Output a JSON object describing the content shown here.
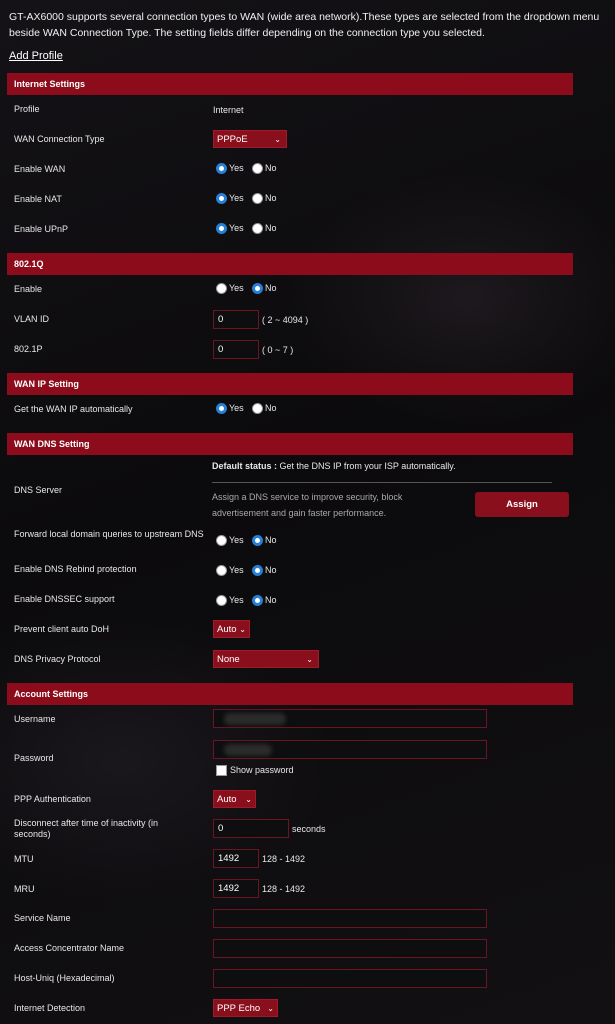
{
  "intro": "GT-AX6000 supports several connection types to WAN (wide area network).These types are selected from the dropdown menu beside WAN Connection Type. The setting fields differ depending on the connection type you selected.",
  "add_profile": "Add Profile",
  "yes": "Yes",
  "no": "No",
  "internet_settings": {
    "title": "Internet Settings",
    "profile_label": "Profile",
    "profile_value": "Internet",
    "wan_type_label": "WAN Connection Type",
    "wan_type_value": "PPPoE",
    "enable_wan_label": "Enable WAN",
    "enable_nat_label": "Enable NAT",
    "enable_upnp_label": "Enable UPnP"
  },
  "dot1q": {
    "title": "802.1Q",
    "enable_label": "Enable",
    "vlan_label": "VLAN ID",
    "vlan_value": "0",
    "vlan_hint": "( 2 ~ 4094 )",
    "p_label": "802.1P",
    "p_value": "0",
    "p_hint": "( 0 ~ 7 )"
  },
  "wan_ip": {
    "title": "WAN IP Setting",
    "auto_label": "Get the WAN IP automatically"
  },
  "wan_dns": {
    "title": "WAN DNS Setting",
    "dns_server_label": "DNS Server",
    "default_status_label": "Default status :",
    "default_status_text": "Get the DNS IP from your ISP automatically.",
    "assign_desc": "Assign a DNS service to improve security, block advertisement and gain faster performance.",
    "assign_button": "Assign",
    "forward_label": "Forward local domain queries to upstream DNS",
    "rebind_label": "Enable DNS Rebind protection",
    "dnssec_label": "Enable DNSSEC support",
    "doh_label": "Prevent client auto DoH",
    "doh_value": "Auto",
    "privacy_label": "DNS Privacy Protocol",
    "privacy_value": "None"
  },
  "account": {
    "title": "Account Settings",
    "username_label": "Username",
    "password_label": "Password",
    "show_password": "Show password",
    "ppp_auth_label": "PPP Authentication",
    "ppp_auth_value": "Auto",
    "idle_label": "Disconnect after time of inactivity (in seconds)",
    "idle_value": "0",
    "idle_unit": "seconds",
    "mtu_label": "MTU",
    "mtu_value": "1492",
    "mtu_hint": "128 - 1492",
    "mru_label": "MRU",
    "mru_value": "1492",
    "mru_hint": "128 - 1492",
    "service_label": "Service Name",
    "ac_label": "Access Concentrator Name",
    "host_uniq_label": "Host-Uniq (Hexadecimal)",
    "detection_label": "Internet Detection",
    "detection_value": "PPP Echo"
  }
}
